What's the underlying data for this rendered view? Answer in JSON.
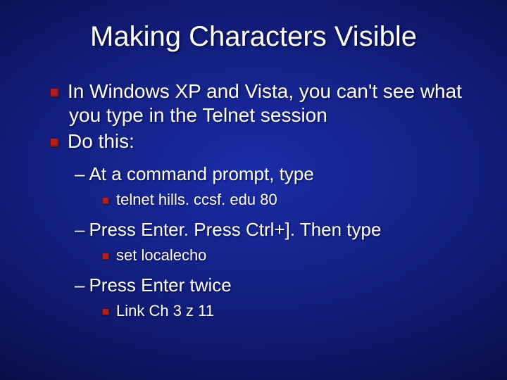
{
  "title": "Making Characters Visible",
  "bullets": {
    "b1": "In Windows XP and Vista, you can't see what you type in the Telnet session",
    "b2": "Do this:",
    "s1": "At a command prompt, type",
    "c1": "telnet hills. ccsf. edu 80",
    "s2": "Press Enter.  Press Ctrl+].  Then type",
    "c2": "set localecho",
    "s3": "Press Enter twice",
    "c3": "Link Ch 3 z 11"
  }
}
